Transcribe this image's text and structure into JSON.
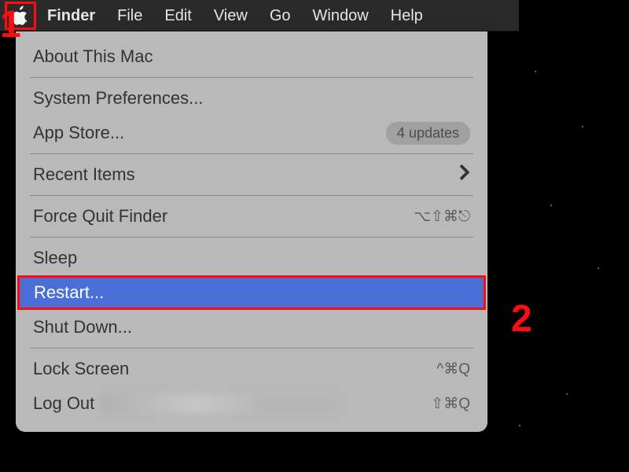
{
  "menubar": {
    "apple_icon": "apple-logo",
    "items": [
      {
        "label": "Finder",
        "bold": true
      },
      {
        "label": "File"
      },
      {
        "label": "Edit"
      },
      {
        "label": "View"
      },
      {
        "label": "Go"
      },
      {
        "label": "Window"
      },
      {
        "label": "Help"
      }
    ]
  },
  "apple_menu": {
    "items": [
      {
        "label": "About This Mac"
      },
      {
        "label": "System Preferences..."
      },
      {
        "label": "App Store...",
        "badge": "4 updates"
      },
      {
        "label": "Recent Items",
        "submenu": true
      },
      {
        "label": "Force Quit Finder",
        "shortcut": "⌥⇧⌘⎋"
      },
      {
        "label": "Sleep"
      },
      {
        "label": "Restart...",
        "highlighted": true
      },
      {
        "label": "Shut Down..."
      },
      {
        "label": "Lock Screen",
        "shortcut": "^⌘Q"
      },
      {
        "label": "Log Out",
        "shortcut": "⇧⌘Q",
        "blurred_suffix": true
      }
    ]
  },
  "annotations": {
    "one": "1",
    "two": "2",
    "color": "#ff0b10"
  }
}
